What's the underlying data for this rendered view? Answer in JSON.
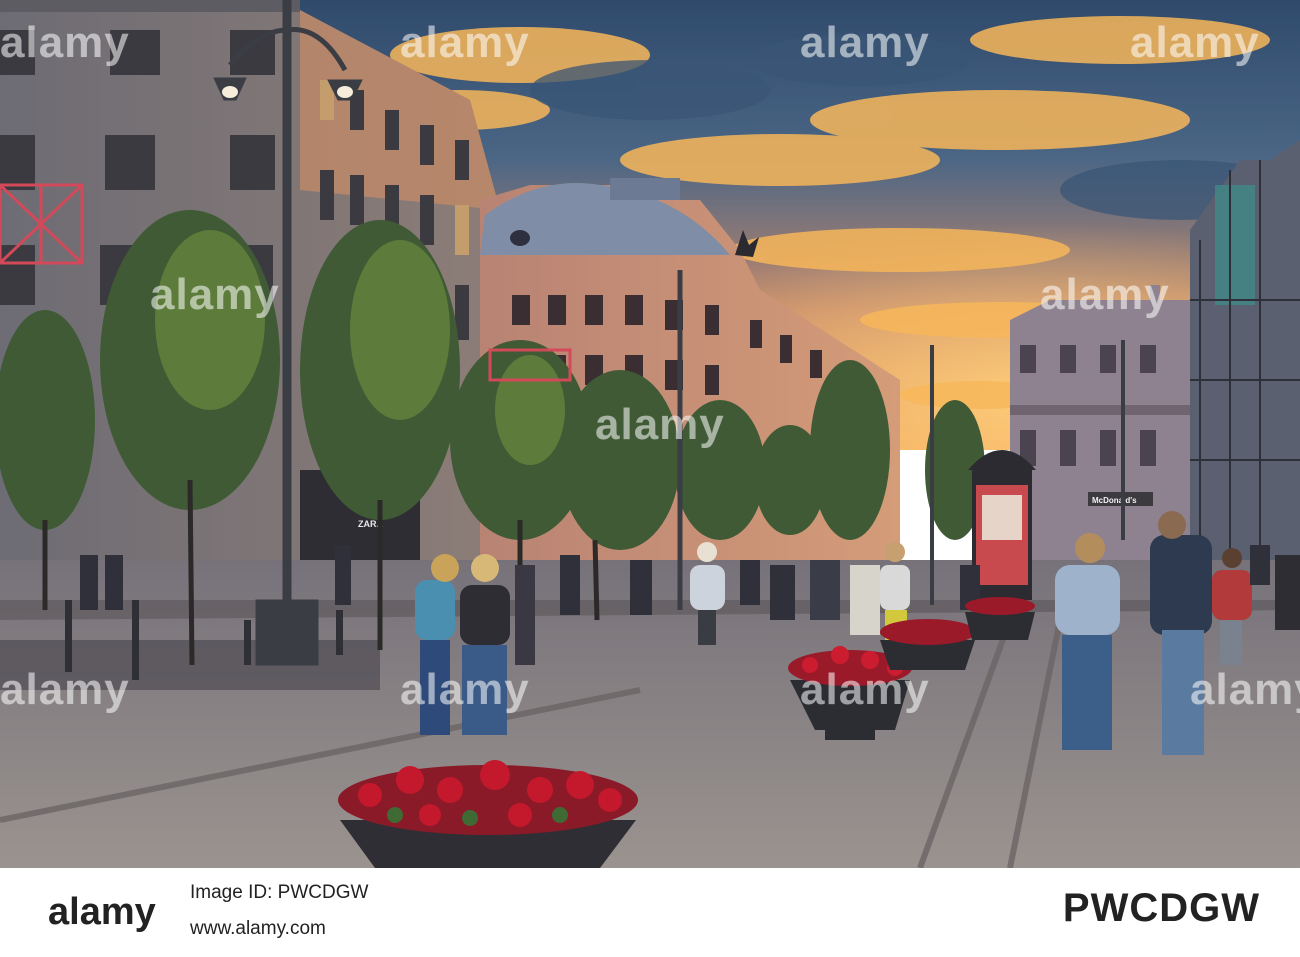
{
  "photo": {
    "scene": "pedestrian-street-at-sunset",
    "signs": {
      "shop_left": "ZARA",
      "shop_right": "McDonald's"
    },
    "colors": {
      "sky_top": "#3e5b7e",
      "sky_glow": "#f2a84a",
      "building_warm": "#c98e74",
      "pavement": "#8c8684",
      "flowers": "#b0142a"
    }
  },
  "watermark": {
    "text": "alamy"
  },
  "footer": {
    "brand_icon": "alamy-logo",
    "image_id": "PWCDGW",
    "caption_line1": "Image ID: PWCDGW",
    "caption_line2": "www.alamy.com"
  }
}
